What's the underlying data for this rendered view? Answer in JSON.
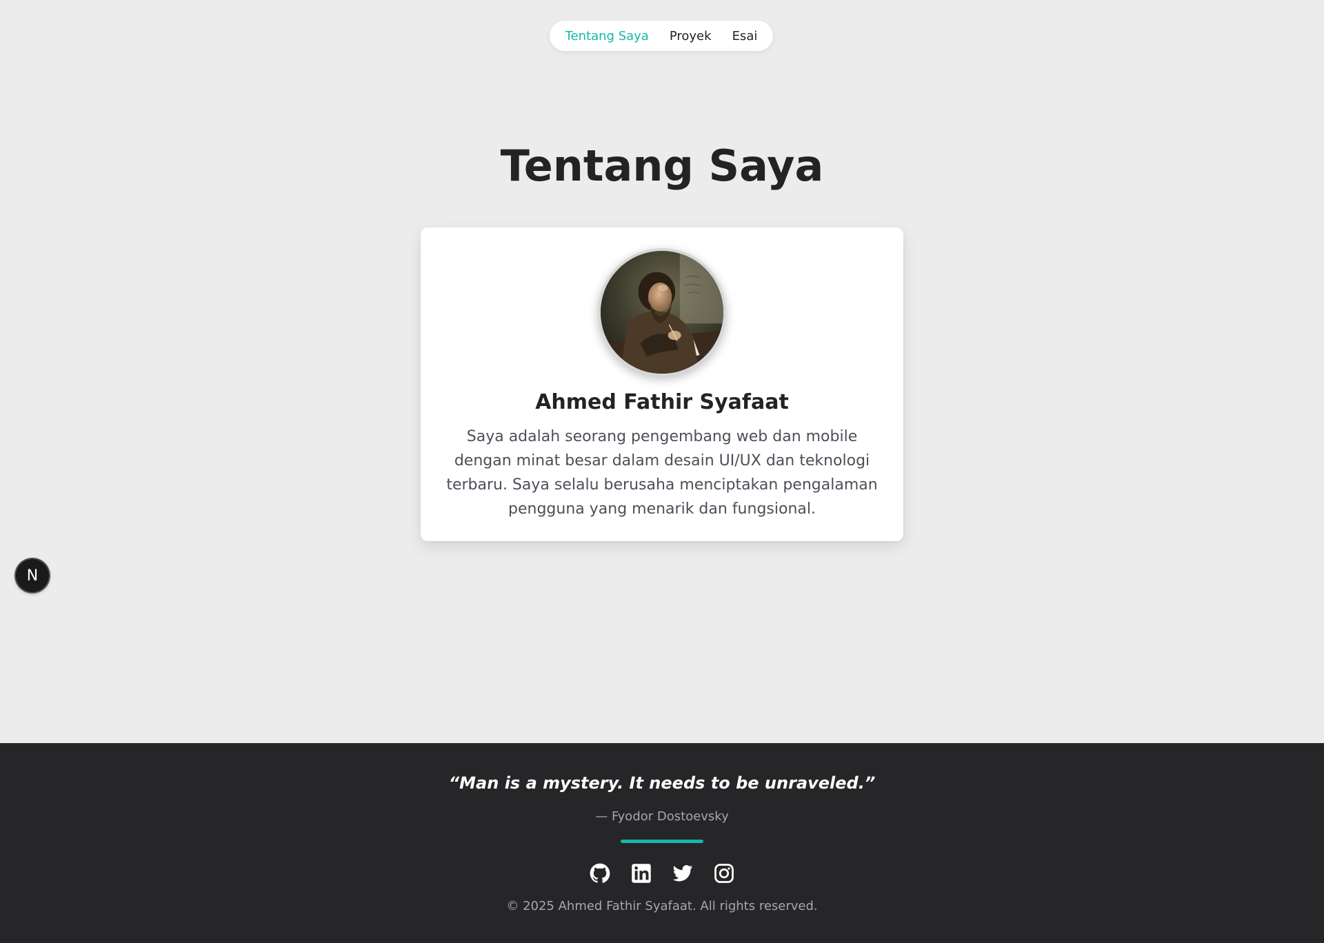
{
  "nav": {
    "items": [
      {
        "label": "Tentang Saya",
        "active": true
      },
      {
        "label": "Proyek",
        "active": false
      },
      {
        "label": "Esai",
        "active": false
      }
    ]
  },
  "page": {
    "title": "Tentang Saya"
  },
  "profile": {
    "name": "Ahmed Fathir Syafaat",
    "bio": "Saya adalah seorang pengembang web dan mobile dengan minat besar dalam desain UI/UX dan teknologi terbaru. Saya selalu berusaha menciptakan pengalaman pengguna yang menarik dan fungsional.",
    "avatar_icon": "portrait-painting"
  },
  "badge": {
    "label": "N",
    "icon": "nextjs-icon"
  },
  "footer": {
    "quote": "“Man is a mystery. It needs to be unraveled.”",
    "quote_author": "— Fyodor Dostoevsky",
    "social_icons": [
      "github-icon",
      "linkedin-icon",
      "twitter-icon",
      "instagram-icon"
    ],
    "copyright": "© 2025 Ahmed Fathir Syafaat. All rights reserved."
  },
  "colors": {
    "accent": "#14b8a6",
    "background": "#ececec",
    "footer_background": "#262628",
    "heading": "#232323",
    "muted_text": "#a3a8b0"
  }
}
